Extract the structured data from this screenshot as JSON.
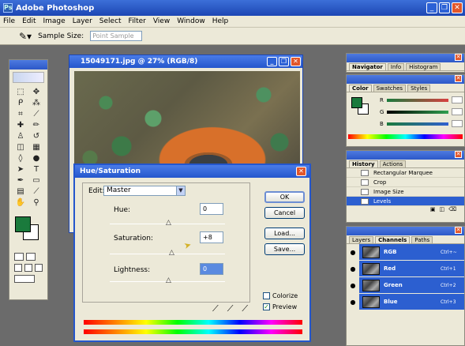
{
  "app": {
    "title": "Adobe Photoshop"
  },
  "menu": [
    "File",
    "Edit",
    "Image",
    "Layer",
    "Select",
    "Filter",
    "View",
    "Window",
    "Help"
  ],
  "options_bar": {
    "sample_label": "Sample Size:",
    "sample_value": "Point Sample"
  },
  "document": {
    "title": "15049171.jpg @ 27% (RGB/8)"
  },
  "dialog": {
    "title": "Hue/Saturation",
    "edit_label": "Edit:",
    "edit_value": "Master",
    "hue_label": "Hue:",
    "hue_value": "0",
    "saturation_label": "Saturation:",
    "saturation_value": "+8",
    "lightness_label": "Lightness:",
    "lightness_value": "0",
    "buttons": {
      "ok": "OK",
      "cancel": "Cancel",
      "load": "Load...",
      "save": "Save..."
    },
    "colorize_label": "Colorize",
    "preview_label": "Preview",
    "colorize_checked": false,
    "preview_checked": true
  },
  "panels": {
    "navigator_tabs": [
      "Navigator",
      "Info",
      "Histogram"
    ],
    "color_tabs": [
      "Color",
      "Swatches",
      "Styles"
    ],
    "color_channels": [
      {
        "label": "R",
        "value": "",
        "color": "#d84040"
      },
      {
        "label": "G",
        "value": "",
        "color": "#30a050"
      },
      {
        "label": "B",
        "value": "",
        "color": "#3060d0"
      }
    ],
    "history_tabs": [
      "History",
      "Actions"
    ],
    "history_items": [
      "Rectangular Marquee",
      "Crop",
      "Image Size",
      "Levels"
    ],
    "channels_tabs": [
      "Layers",
      "Channels",
      "Paths"
    ],
    "channels": [
      {
        "name": "RGB",
        "shortcut": "Ctrl+~"
      },
      {
        "name": "Red",
        "shortcut": "Ctrl+1"
      },
      {
        "name": "Green",
        "shortcut": "Ctrl+2"
      },
      {
        "name": "Blue",
        "shortcut": "Ctrl+3"
      }
    ]
  },
  "colors": {
    "foreground": "#1a7a3c",
    "background": "#ffffff",
    "titlebar": "#2456cc",
    "selection": "#2c5fd0"
  }
}
